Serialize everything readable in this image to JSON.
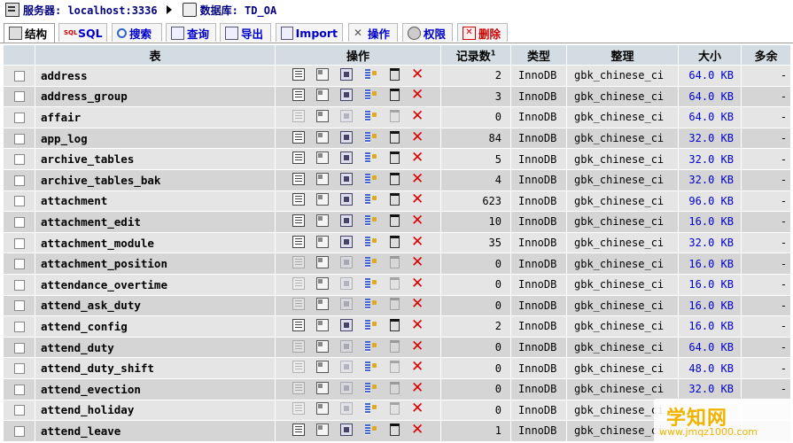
{
  "breadcrumb": {
    "server_label": "服务器: localhost:3336",
    "db_label": "数据库: TD_OA"
  },
  "tabs": [
    {
      "label": "结构",
      "icon": "structure-icon"
    },
    {
      "label": "SQL",
      "icon": "sql-icon"
    },
    {
      "label": "搜索",
      "icon": "search-icon"
    },
    {
      "label": "查询",
      "icon": "query-icon"
    },
    {
      "label": "导出",
      "icon": "export-icon"
    },
    {
      "label": "Import",
      "icon": "import-icon"
    },
    {
      "label": "操作",
      "icon": "operations-icon"
    },
    {
      "label": "权限",
      "icon": "privileges-icon"
    },
    {
      "label": "删除",
      "icon": "drop-icon"
    }
  ],
  "columns": {
    "table": "表",
    "actions": "操作",
    "records": "记录数",
    "records_sup": "1",
    "type": "类型",
    "collation": "整理",
    "size": "大小",
    "overhead": "多余"
  },
  "rows": [
    {
      "name": "address",
      "records": "2",
      "type": "InnoDB",
      "collation": "gbk_chinese_ci",
      "size": "64.0 KB",
      "overhead": "-",
      "empty": false
    },
    {
      "name": "address_group",
      "records": "3",
      "type": "InnoDB",
      "collation": "gbk_chinese_ci",
      "size": "64.0 KB",
      "overhead": "-",
      "empty": false
    },
    {
      "name": "affair",
      "records": "0",
      "type": "InnoDB",
      "collation": "gbk_chinese_ci",
      "size": "64.0 KB",
      "overhead": "-",
      "empty": true
    },
    {
      "name": "app_log",
      "records": "84",
      "type": "InnoDB",
      "collation": "gbk_chinese_ci",
      "size": "32.0 KB",
      "overhead": "-",
      "empty": false
    },
    {
      "name": "archive_tables",
      "records": "5",
      "type": "InnoDB",
      "collation": "gbk_chinese_ci",
      "size": "32.0 KB",
      "overhead": "-",
      "empty": false
    },
    {
      "name": "archive_tables_bak",
      "records": "4",
      "type": "InnoDB",
      "collation": "gbk_chinese_ci",
      "size": "32.0 KB",
      "overhead": "-",
      "empty": false
    },
    {
      "name": "attachment",
      "records": "623",
      "type": "InnoDB",
      "collation": "gbk_chinese_ci",
      "size": "96.0 KB",
      "overhead": "-",
      "empty": false
    },
    {
      "name": "attachment_edit",
      "records": "10",
      "type": "InnoDB",
      "collation": "gbk_chinese_ci",
      "size": "16.0 KB",
      "overhead": "-",
      "empty": false
    },
    {
      "name": "attachment_module",
      "records": "35",
      "type": "InnoDB",
      "collation": "gbk_chinese_ci",
      "size": "32.0 KB",
      "overhead": "-",
      "empty": false
    },
    {
      "name": "attachment_position",
      "records": "0",
      "type": "InnoDB",
      "collation": "gbk_chinese_ci",
      "size": "16.0 KB",
      "overhead": "-",
      "empty": true
    },
    {
      "name": "attendance_overtime",
      "records": "0",
      "type": "InnoDB",
      "collation": "gbk_chinese_ci",
      "size": "16.0 KB",
      "overhead": "-",
      "empty": true
    },
    {
      "name": "attend_ask_duty",
      "records": "0",
      "type": "InnoDB",
      "collation": "gbk_chinese_ci",
      "size": "16.0 KB",
      "overhead": "-",
      "empty": true
    },
    {
      "name": "attend_config",
      "records": "2",
      "type": "InnoDB",
      "collation": "gbk_chinese_ci",
      "size": "16.0 KB",
      "overhead": "-",
      "empty": false
    },
    {
      "name": "attend_duty",
      "records": "0",
      "type": "InnoDB",
      "collation": "gbk_chinese_ci",
      "size": "64.0 KB",
      "overhead": "-",
      "empty": true
    },
    {
      "name": "attend_duty_shift",
      "records": "0",
      "type": "InnoDB",
      "collation": "gbk_chinese_ci",
      "size": "48.0 KB",
      "overhead": "-",
      "empty": true
    },
    {
      "name": "attend_evection",
      "records": "0",
      "type": "InnoDB",
      "collation": "gbk_chinese_ci",
      "size": "32.0 KB",
      "overhead": "-",
      "empty": true
    },
    {
      "name": "attend_holiday",
      "records": "0",
      "type": "InnoDB",
      "collation": "gbk_chinese_ci",
      "size": "",
      "overhead": "",
      "empty": true
    },
    {
      "name": "attend_leave",
      "records": "1",
      "type": "InnoDB",
      "collation": "gbk_chinese_ci",
      "size": "",
      "overhead": "",
      "empty": false
    }
  ],
  "watermark": {
    "title": "学知网",
    "url": "www.jmqz1000.com"
  }
}
